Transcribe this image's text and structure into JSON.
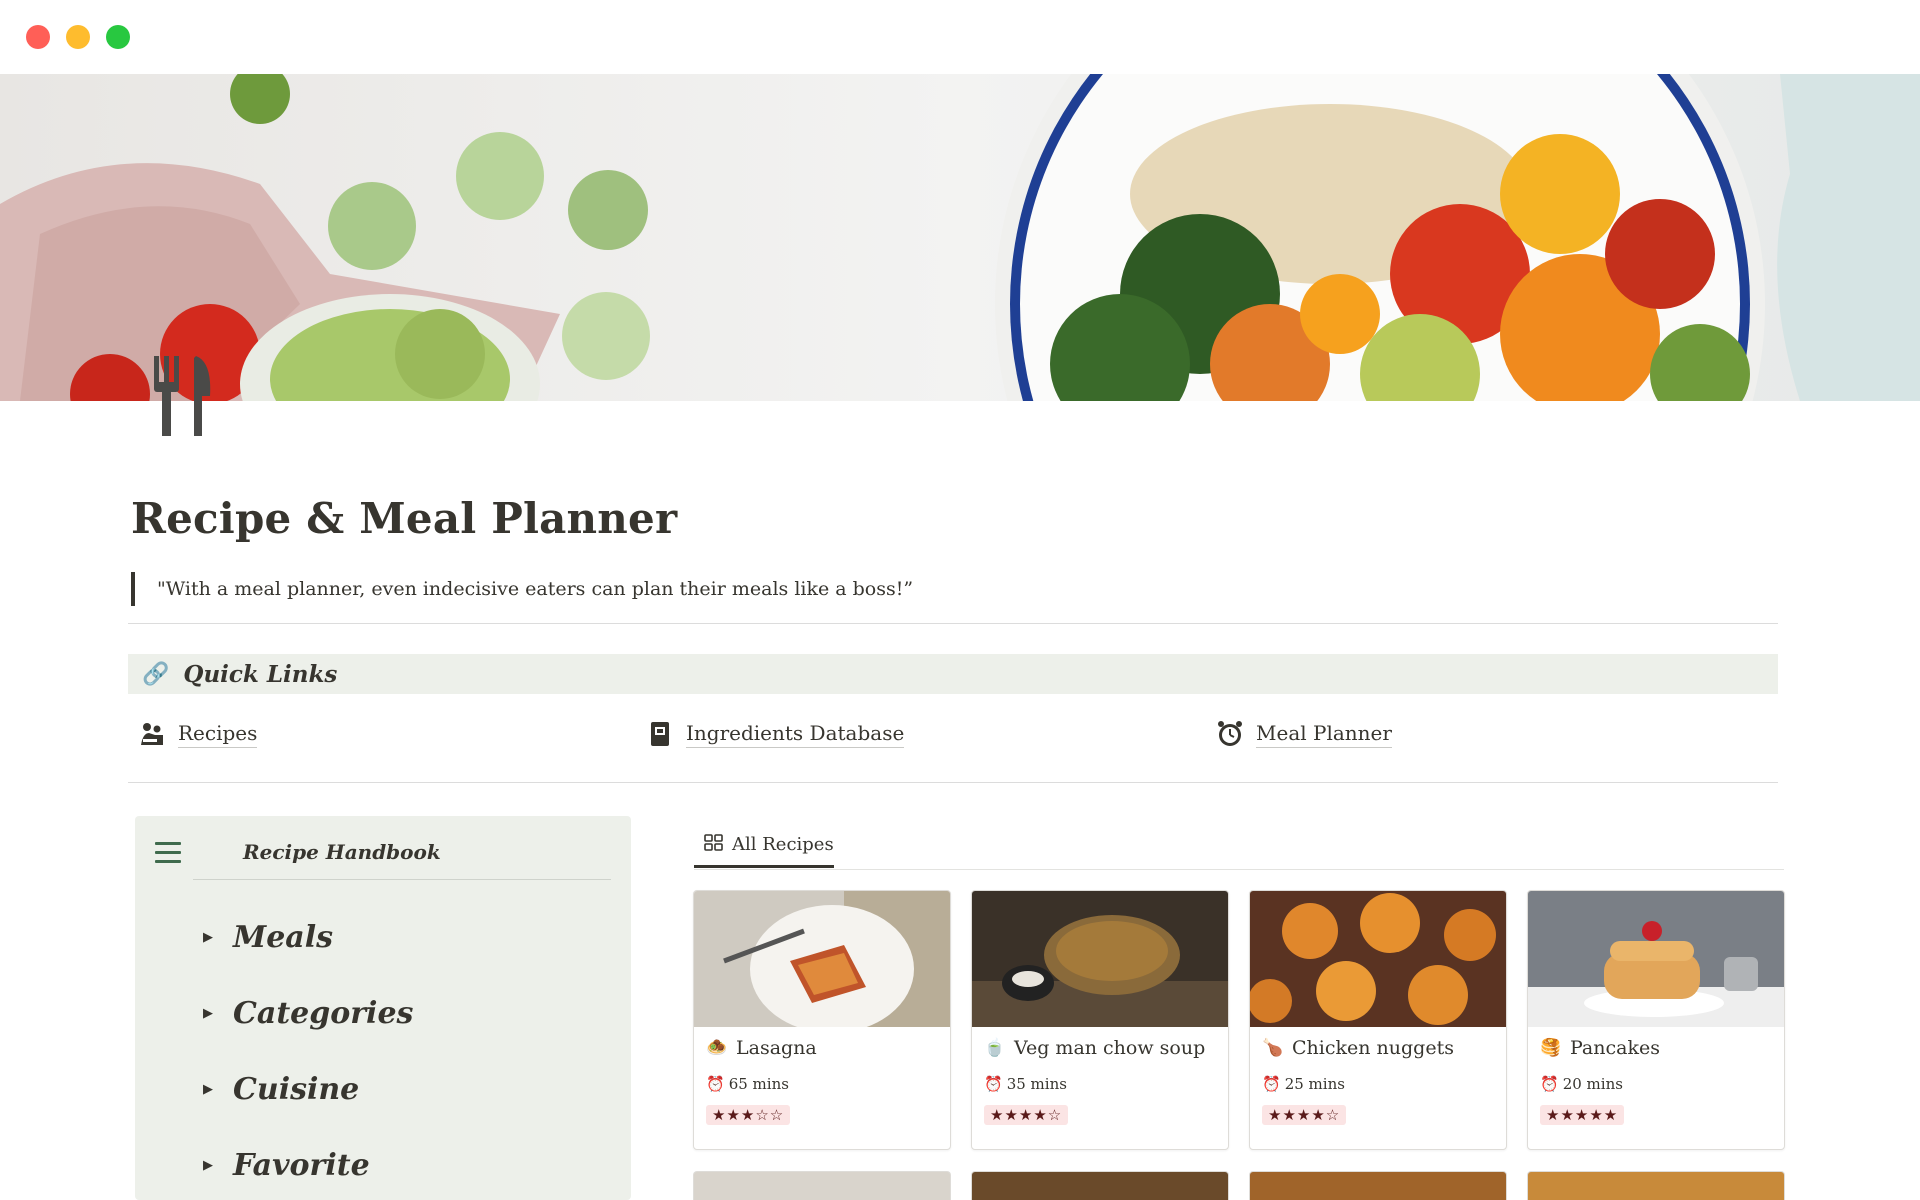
{
  "page": {
    "title": "Recipe & Meal Planner",
    "quote": "\"With a meal planner, even indecisive eaters can plan their meals like a boss!”",
    "icon": "fork-knife-icon"
  },
  "quick_links": {
    "heading": "Quick Links",
    "heading_icon": "link-icon",
    "items": [
      {
        "label": "Recipes",
        "icon": "cooking-people-icon"
      },
      {
        "label": "Ingredients Database",
        "icon": "book-icon"
      },
      {
        "label": "Meal Planner",
        "icon": "alarm-clock-icon"
      }
    ]
  },
  "handbook": {
    "title": "Recipe Handbook",
    "menu_icon": "hamburger-icon",
    "toggles": [
      {
        "label": "Meals"
      },
      {
        "label": "Categories"
      },
      {
        "label": "Cuisine"
      },
      {
        "label": "Favorite"
      }
    ]
  },
  "gallery": {
    "tab_label": "All Recipes",
    "tab_icon": "gallery-grid-icon",
    "cards": [
      {
        "name": "Lasagna",
        "icon": "🧆",
        "time": "65 mins",
        "rating": "★★★☆☆",
        "rating_value": 3
      },
      {
        "name": "Veg man chow soup",
        "icon": "🍵",
        "time": "35 mins",
        "rating": "★★★★☆",
        "rating_value": 4
      },
      {
        "name": "Chicken nuggets",
        "icon": "🍗",
        "time": "25 mins",
        "rating": "★★★★☆",
        "rating_value": 4
      },
      {
        "name": "Pancakes",
        "icon": "🥞",
        "time": "20 mins",
        "rating": "★★★★★",
        "rating_value": 5
      }
    ]
  },
  "colors": {
    "quick_links_bg": "#edf0ea",
    "rating_bg": "#fbe4e4",
    "rating_fg": "#5a1a1a",
    "accent_green": "#3f6b4d"
  }
}
